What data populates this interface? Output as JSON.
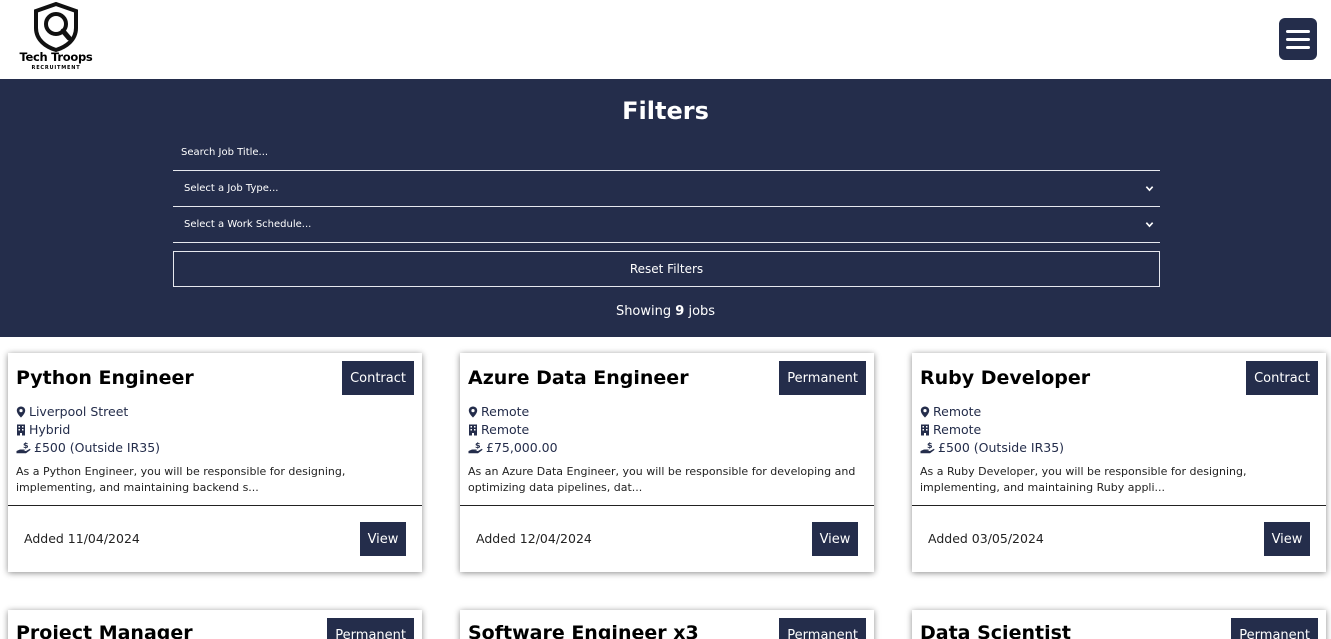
{
  "brand": {
    "name": "Tech Troops",
    "tagline": "RECRUITMENT"
  },
  "filters": {
    "heading": "Filters",
    "search_placeholder": "Search Job Title...",
    "job_type_placeholder": "Select a Job Type...",
    "work_schedule_placeholder": "Select a Work Schedule...",
    "reset_label": "Reset Filters",
    "showing_prefix": "Showing",
    "showing_count": "9",
    "showing_suffix": "jobs"
  },
  "jobs": [
    {
      "title": "Python Engineer",
      "type": "Contract",
      "location": "Liverpool Street",
      "schedule": "Hybrid",
      "salary": "£500 (Outside IR35)",
      "description": "As a Python Engineer, you will be responsible for designing, implementing, and maintaining backend s...",
      "added": "Added 11/04/2024",
      "view_label": "View"
    },
    {
      "title": "Azure Data Engineer",
      "type": "Permanent",
      "location": "Remote",
      "schedule": "Remote",
      "salary": "£75,000.00",
      "description": "As an Azure Data Engineer, you will be responsible for developing and optimizing data pipelines, dat...",
      "added": "Added 12/04/2024",
      "view_label": "View"
    },
    {
      "title": "Ruby Developer",
      "type": "Contract",
      "location": "Remote",
      "schedule": "Remote",
      "salary": "£500 (Outside IR35)",
      "description": "As a Ruby Developer, you will be responsible for designing, implementing, and maintaining Ruby appli...",
      "added": "Added 03/05/2024",
      "view_label": "View"
    },
    {
      "title": "Project Manager",
      "type": "Permanent"
    },
    {
      "title": "Software Engineer x3",
      "type": "Permanent"
    },
    {
      "title": "Data Scientist",
      "type": "Permanent"
    }
  ],
  "colors": {
    "navy": "#242d4b",
    "white": "#ffffff"
  },
  "icons": {
    "location": "map-pin-icon",
    "schedule": "building-icon",
    "salary": "money-hand-icon",
    "menu": "hamburger-icon"
  }
}
